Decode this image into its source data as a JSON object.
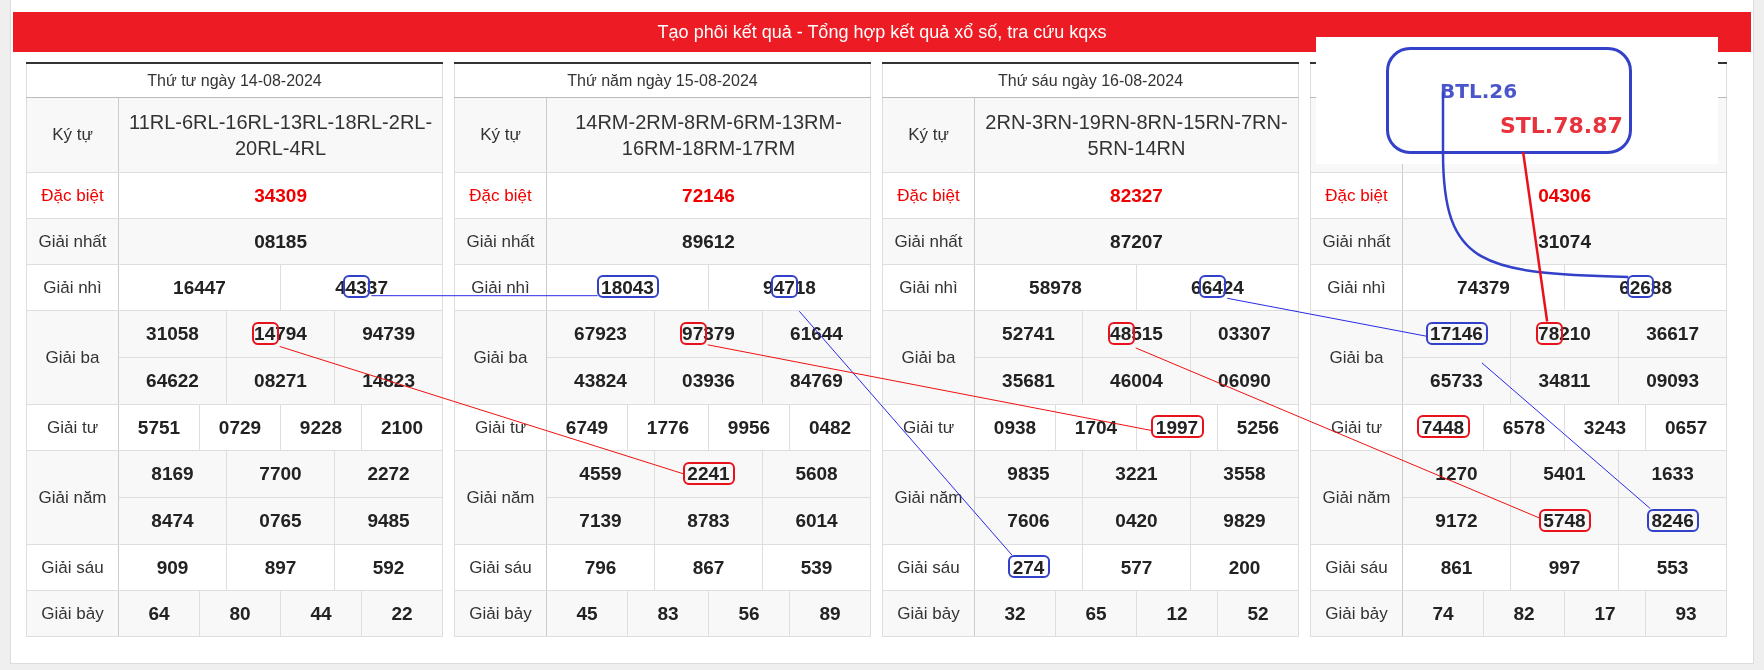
{
  "header": {
    "title": "Tạo phôi kết quả - Tổng hợp kết quả xổ số, tra cứu kqxs"
  },
  "days": [
    {
      "date": "Thứ tư ngày 14-08-2024",
      "rows": [
        {
          "kind": "code",
          "label": "Ký tự",
          "text": "11RL-6RL-16RL-13RL-18RL-2RL-20RL-4RL"
        },
        {
          "kind": "special",
          "label": "Đặc biệt",
          "lines": [
            [
              "34309"
            ]
          ]
        },
        {
          "kind": "prize",
          "label": "Giải nhất",
          "lines": [
            [
              "08185"
            ]
          ]
        },
        {
          "kind": "prize",
          "label": "Giải nhì",
          "lines": [
            [
              "16447",
              {
                "pre": "4",
                "marked": "43",
                "post": "37",
                "color": "#3340c8"
              }
            ]
          ]
        },
        {
          "kind": "prize",
          "label": "Giải ba",
          "lines": [
            [
              "31058",
              {
                "marked": "14",
                "post": "794",
                "color": "#e8121c"
              },
              "94739"
            ],
            [
              "64622",
              "08271",
              "14823"
            ]
          ]
        },
        {
          "kind": "prize",
          "label": "Giải tư",
          "lines": [
            [
              "5751",
              "0729",
              "9228",
              "2100"
            ]
          ]
        },
        {
          "kind": "prize",
          "label": "Giải năm",
          "lines": [
            [
              "8169",
              "7700",
              "2272"
            ],
            [
              "8474",
              "0765",
              "9485"
            ]
          ]
        },
        {
          "kind": "prize",
          "label": "Giải sáu",
          "lines": [
            [
              "909",
              "897",
              "592"
            ]
          ]
        },
        {
          "kind": "prize",
          "label": "Giải bảy",
          "lines": [
            [
              "64",
              "80",
              "44",
              "22"
            ]
          ]
        }
      ]
    },
    {
      "date": "Thứ năm ngày 15-08-2024",
      "rows": [
        {
          "kind": "code",
          "label": "Ký tự",
          "text": "14RM-2RM-8RM-6RM-13RM-16RM-18RM-17RM"
        },
        {
          "kind": "special",
          "label": "Đặc biệt",
          "lines": [
            [
              "72146"
            ]
          ]
        },
        {
          "kind": "prize",
          "label": "Giải nhất",
          "lines": [
            [
              "89612"
            ]
          ]
        },
        {
          "kind": "prize",
          "label": "Giải nhì",
          "lines": [
            [
              {
                "marked": "18043",
                "color": "#3340c8"
              },
              {
                "pre": "9",
                "marked": "47",
                "post": "18",
                "color": "#3340c8"
              }
            ]
          ]
        },
        {
          "kind": "prize",
          "label": "Giải ba",
          "lines": [
            [
              "67923",
              {
                "marked": "97",
                "post": "379",
                "color": "#e8121c"
              },
              "61644"
            ],
            [
              "43824",
              "03936",
              "84769"
            ]
          ]
        },
        {
          "kind": "prize",
          "label": "Giải tư",
          "lines": [
            [
              "6749",
              "1776",
              "9956",
              "0482"
            ]
          ]
        },
        {
          "kind": "prize",
          "label": "Giải năm",
          "lines": [
            [
              "4559",
              {
                "marked": "2241",
                "color": "#e8121c"
              },
              "5608"
            ],
            [
              "7139",
              "8783",
              "6014"
            ]
          ]
        },
        {
          "kind": "prize",
          "label": "Giải sáu",
          "lines": [
            [
              "796",
              "867",
              "539"
            ]
          ]
        },
        {
          "kind": "prize",
          "label": "Giải bảy",
          "lines": [
            [
              "45",
              "83",
              "56",
              "89"
            ]
          ]
        }
      ]
    },
    {
      "date": "Thứ sáu ngày 16-08-2024",
      "rows": [
        {
          "kind": "code",
          "label": "Ký tự",
          "text": "2RN-3RN-19RN-8RN-15RN-7RN-5RN-14RN"
        },
        {
          "kind": "special",
          "label": "Đặc biệt",
          "lines": [
            [
              "82327"
            ]
          ]
        },
        {
          "kind": "prize",
          "label": "Giải nhất",
          "lines": [
            [
              "87207"
            ]
          ]
        },
        {
          "kind": "prize",
          "label": "Giải nhì",
          "lines": [
            [
              "58978",
              {
                "pre": "6",
                "marked": "64",
                "post": "24",
                "color": "#3340c8"
              }
            ]
          ]
        },
        {
          "kind": "prize",
          "label": "Giải ba",
          "lines": [
            [
              "52741",
              {
                "marked": "48",
                "post": "515",
                "color": "#e8121c"
              },
              "03307"
            ],
            [
              "35681",
              "46004",
              "06090"
            ]
          ]
        },
        {
          "kind": "prize",
          "label": "Giải tư",
          "lines": [
            [
              "0938",
              "1704",
              {
                "marked": "1997",
                "color": "#e8121c"
              },
              "5256"
            ]
          ]
        },
        {
          "kind": "prize",
          "label": "Giải năm",
          "lines": [
            [
              "9835",
              "3221",
              "3558"
            ],
            [
              "7606",
              "0420",
              "9829"
            ]
          ]
        },
        {
          "kind": "prize",
          "label": "Giải sáu",
          "lines": [
            [
              {
                "marked": "274",
                "color": "#3340c8"
              },
              "577",
              "200"
            ]
          ]
        },
        {
          "kind": "prize",
          "label": "Giải bảy",
          "lines": [
            [
              "32",
              "65",
              "12",
              "52"
            ]
          ]
        }
      ]
    },
    {
      "rows": [
        {
          "kind": "code"
        },
        {
          "kind": "special",
          "label": "Đặc biệt",
          "lines": [
            [
              "04306"
            ]
          ]
        },
        {
          "kind": "prize",
          "label": "Giải nhất",
          "lines": [
            [
              "31074"
            ]
          ]
        },
        {
          "kind": "prize",
          "label": "Giải nhì",
          "lines": [
            [
              "74379",
              {
                "pre": "6",
                "marked": "26",
                "post": "88",
                "color": "#3340c8"
              }
            ]
          ]
        },
        {
          "kind": "prize",
          "label": "Giải ba",
          "lines": [
            [
              {
                "marked": "17146",
                "color": "#3340c8"
              },
              {
                "marked": "78",
                "post": "210",
                "color": "#e8121c"
              },
              "36617"
            ],
            [
              "65733",
              "34811",
              "09093"
            ]
          ]
        },
        {
          "kind": "prize",
          "label": "Giải tư",
          "lines": [
            [
              {
                "marked": "7448",
                "color": "#e8121c"
              },
              "6578",
              "3243",
              "0657"
            ]
          ]
        },
        {
          "kind": "prize",
          "label": "Giải năm",
          "lines": [
            [
              "1270",
              "5401",
              "1633"
            ],
            [
              "9172",
              {
                "marked": "5748",
                "color": "#e8121c"
              },
              {
                "marked": "8246",
                "color": "#3340c8"
              }
            ]
          ]
        },
        {
          "kind": "prize",
          "label": "Giải sáu",
          "lines": [
            [
              "861",
              "997",
              "553"
            ]
          ]
        },
        {
          "kind": "prize",
          "label": "Giải bảy",
          "lines": [
            [
              "74",
              "82",
              "17",
              "93"
            ]
          ]
        }
      ]
    }
  ],
  "note": {
    "labels": [
      {
        "text": "BTL.26",
        "color": "#4a55cc"
      },
      {
        "text": "STL.78.87",
        "color": "#e8323c"
      }
    ]
  }
}
